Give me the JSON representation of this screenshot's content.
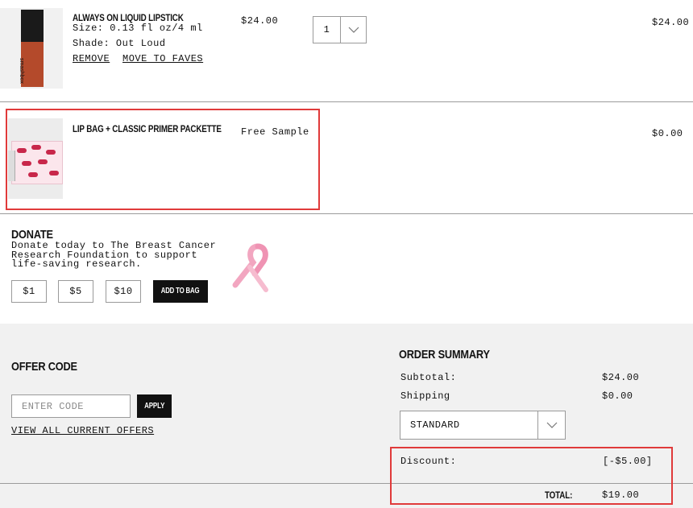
{
  "items": [
    {
      "name": "ALWAYS ON LIQUID LIPSTICK",
      "size": "Size: 0.13 fl oz/4 ml",
      "shade": "Shade: Out Loud",
      "unit_price": "$24.00",
      "quantity": "1",
      "line_total": "$24.00",
      "remove_label": "REMOVE",
      "move_label": "MOVE TO FAVES",
      "image_brand_text": "smashbox"
    },
    {
      "name": "LIP BAG + CLASSIC PRIMER PACKETTE",
      "price_note": "Free Sample",
      "line_total": "$0.00"
    }
  ],
  "donate": {
    "title": "DONATE",
    "description_lines": [
      "Donate today to The Breast Cancer",
      "Research Foundation to support",
      "life-saving research."
    ],
    "amounts": [
      "$1",
      "$5",
      "$10"
    ],
    "add_label": "ADD TO BAG",
    "ribbon_color": "#f2a6c0"
  },
  "offer": {
    "title": "OFFER CODE",
    "placeholder": "ENTER CODE",
    "apply_label": "APPLY",
    "view_all_label": "VIEW ALL CURRENT OFFERS"
  },
  "summary": {
    "title": "ORDER SUMMARY",
    "subtotal_label": "Subtotal:",
    "subtotal_value": "$24.00",
    "shipping_label": "Shipping",
    "shipping_value": "$0.00",
    "shipping_method": "STANDARD",
    "discount_label": "Discount:",
    "discount_value": "[-$5.00]",
    "total_label": "TOTAL:",
    "total_value": "$19.00"
  },
  "colors": {
    "highlight": "#e03a3a",
    "grey_panel": "#f1f1f1",
    "black_button": "#111111"
  }
}
